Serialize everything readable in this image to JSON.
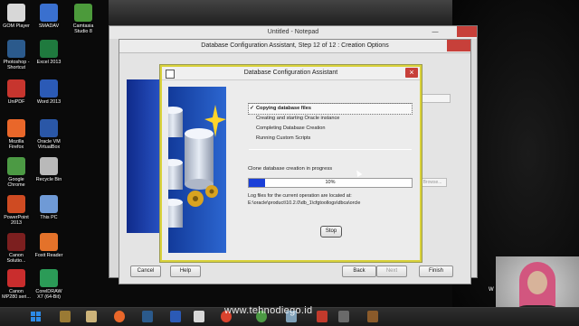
{
  "desktop": {
    "icons": [
      {
        "label": "GOM Player",
        "color": "#d7d7d7",
        "x": 0
      },
      {
        "label": "SMADAV",
        "color": "#3a70cf",
        "x": 1
      },
      {
        "label": "Camtasia\nStudio 8",
        "color": "#4c9a3b",
        "x": 2
      },
      {
        "label": "Photoshop -\nShortcut",
        "color": "#2b5a8c",
        "x": 3
      },
      {
        "label": "Excel 2013",
        "color": "#1f7a3e",
        "x": 4
      },
      {
        "label": "UniPDF",
        "color": "#c7352e",
        "x": 5
      },
      {
        "label": "Word 2013",
        "color": "#2b5ab6",
        "x": 6
      },
      {
        "label": "Mozilla\nFirefox",
        "color": "#e9672a",
        "x": 7
      },
      {
        "label": "Oracle VM\nVirtualBox",
        "color": "#2a57a7",
        "x": 8
      },
      {
        "label": "Google\nChrome",
        "color": "#4c9a44",
        "x": 9
      },
      {
        "label": "Recycle Bin",
        "color": "#b9b9b9",
        "x": 10
      },
      {
        "label": "PowerPoint\n2013",
        "color": "#cf4b22",
        "x": 11
      },
      {
        "label": "This PC",
        "color": "#6f9ad6",
        "x": 12
      },
      {
        "label": "Canon\nSolutio...",
        "color": "#7c1f1f",
        "x": 13
      },
      {
        "label": "Foxit Reader",
        "color": "#e4722a",
        "x": 14
      },
      {
        "label": "Canon\nMP280 seri...",
        "color": "#c92d2d",
        "x": 15
      },
      {
        "label": "CorelDRAW\nX7 (64-Bit)",
        "color": "#2b9b57",
        "x": 16
      }
    ]
  },
  "notepad": {
    "title": "Untitled - Notepad"
  },
  "outer": {
    "title": "Database Configuration Assistant, Step 12 of 12 : Creation Options",
    "cancel": "Cancel",
    "help": "Help",
    "back": "Back",
    "next": "Next",
    "finish": "Finish",
    "browse": "Browse..."
  },
  "dialog": {
    "title": "Database Configuration Assistant",
    "steps": [
      "Copying database files",
      "Creating and starting Oracle instance",
      "Completing Database Creation",
      "Running Custom Scripts"
    ],
    "status": "Clone database creation in progress",
    "progress_value": 0.1,
    "progress_label": "10%",
    "log_line1": "Log files for the current operation are located at:",
    "log_line2": "E:\\oracle\\product\\10.2.0\\db_1\\cfgtoollogs\\dbca\\orcle",
    "stop": "Stop"
  },
  "overlay": {
    "watermark": "www.tehnodiego.id",
    "webcam_letter": "W"
  },
  "colors": {
    "accent": "#1a3fd8",
    "dialog_border": "#d9d23a",
    "close_red": "#c7403a"
  }
}
